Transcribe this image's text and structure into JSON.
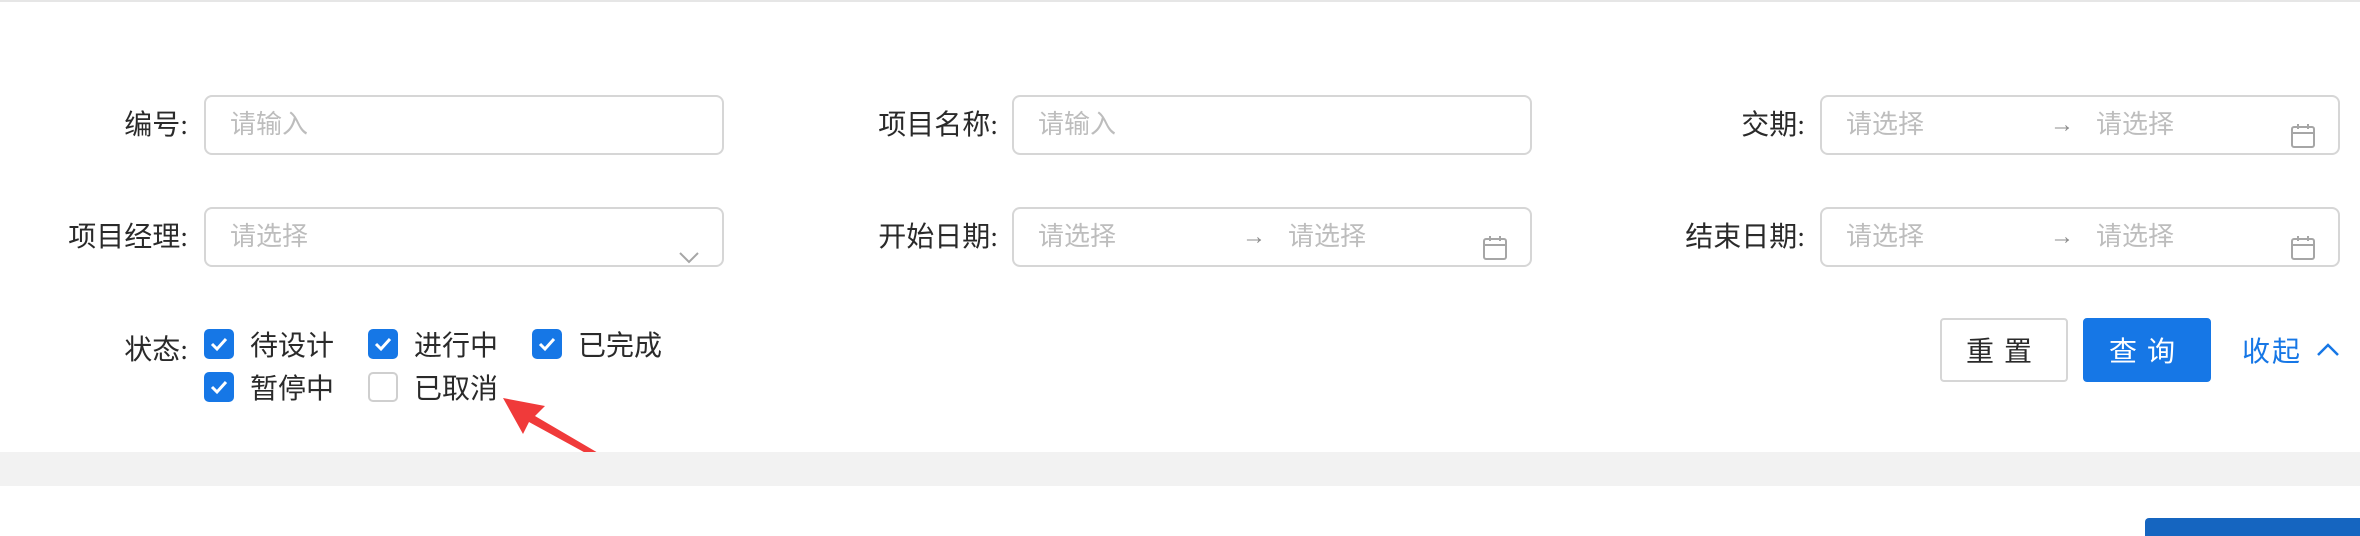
{
  "filters": {
    "code": {
      "label": "编号:",
      "placeholder": "请输入"
    },
    "project_name": {
      "label": "项目名称:",
      "placeholder": "请输入"
    },
    "delivery": {
      "label": "交期:",
      "start_placeholder": "请选择",
      "end_placeholder": "请选择"
    },
    "manager": {
      "label": "项目经理:",
      "placeholder": "请选择"
    },
    "start_date": {
      "label": "开始日期:",
      "start_placeholder": "请选择",
      "end_placeholder": "请选择"
    },
    "end_date": {
      "label": "结束日期:",
      "start_placeholder": "请选择",
      "end_placeholder": "请选择"
    },
    "range_separator": "→",
    "status": {
      "label": "状态:",
      "options": [
        {
          "label": "待设计",
          "checked": true
        },
        {
          "label": "进行中",
          "checked": true
        },
        {
          "label": "已完成",
          "checked": true
        },
        {
          "label": "暂停中",
          "checked": true
        },
        {
          "label": "已取消",
          "checked": false
        }
      ]
    }
  },
  "actions": {
    "reset_label": "重置",
    "query_label": "查询",
    "collapse_label": "收起"
  },
  "colors": {
    "accent": "#1677e6",
    "annotation_arrow": "#f03a3a"
  },
  "icons": [
    "calendar-icon",
    "chevron-down-icon",
    "chevron-up-icon",
    "check-icon",
    "annotation-arrow-icon"
  ]
}
